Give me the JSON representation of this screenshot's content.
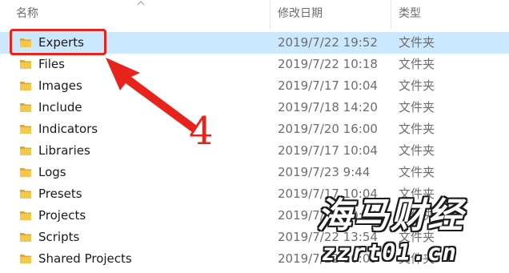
{
  "header": {
    "name_label": "名称",
    "date_label": "修改日期",
    "type_label": "类型"
  },
  "files": [
    {
      "name": "Experts",
      "date": "2019/7/22 19:52",
      "type": "文件夹",
      "selected": true
    },
    {
      "name": "Files",
      "date": "2019/7/22 10:18",
      "type": "文件夹"
    },
    {
      "name": "Images",
      "date": "2019/7/17 10:04",
      "type": "文件夹"
    },
    {
      "name": "Include",
      "date": "2019/7/18 14:20",
      "type": "文件夹"
    },
    {
      "name": "Indicators",
      "date": "2019/7/20 16:00",
      "type": "文件夹"
    },
    {
      "name": "Libraries",
      "date": "2019/7/17 10:04",
      "type": "文件夹"
    },
    {
      "name": "Logs",
      "date": "2019/7/23 9:44",
      "type": "文件夹"
    },
    {
      "name": "Presets",
      "date": "2019/7/17 10:04",
      "type": "文件夹"
    },
    {
      "name": "Projects",
      "date": "2019/7/17 10:04",
      "type": "文件夹"
    },
    {
      "name": "Scripts",
      "date": "2019/7/22 13:54",
      "type": "文件夹"
    },
    {
      "name": "Shared Projects",
      "date": "2019/7/22 10:09",
      "type": "文件夹"
    }
  ],
  "annotation": {
    "step_number": "4",
    "color": "#e8231c"
  },
  "watermark": {
    "title": "海马财经",
    "url": "zzrt01.cn"
  },
  "colors": {
    "selected_row": "#cce8ff",
    "folder": "#f4c84a",
    "text_secondary": "#6d6d6d"
  },
  "icons": {
    "folder": "folder-icon",
    "sort": "sort-ascending-icon"
  }
}
